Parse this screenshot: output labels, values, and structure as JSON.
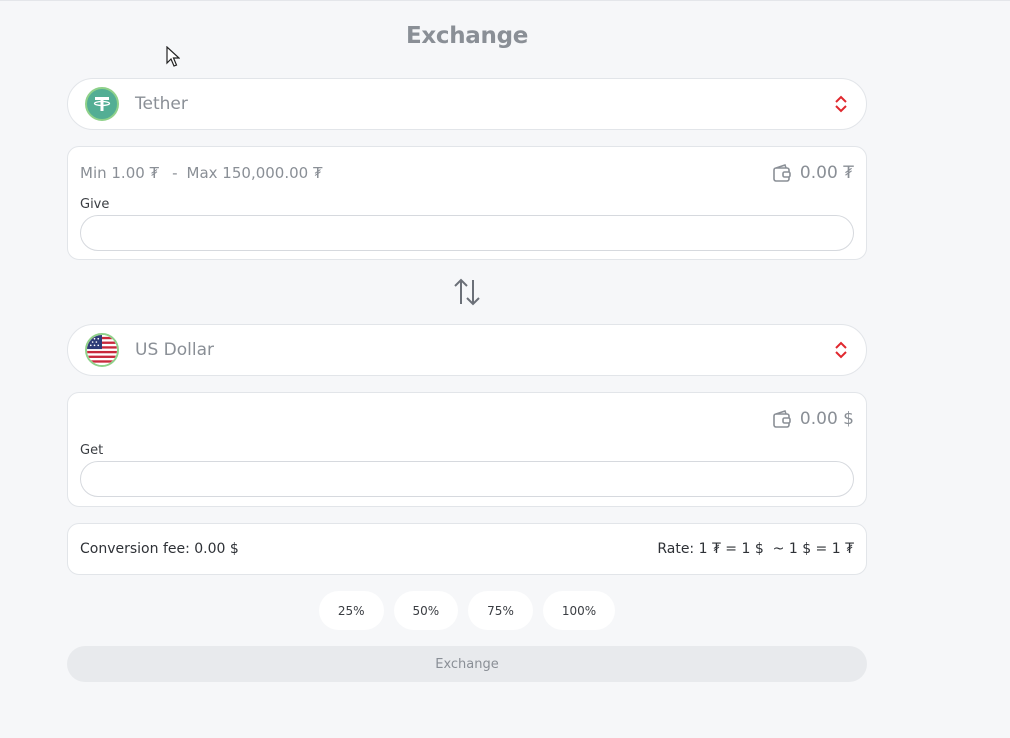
{
  "page": {
    "title": "Exchange"
  },
  "give": {
    "currency": "Tether",
    "min_label": "Min 1.00 ₮",
    "separator": "-",
    "max_label": "Max 150,000.00 ₮",
    "balance": "0.00 ₮",
    "field_label": "Give",
    "value": "",
    "placeholder": ""
  },
  "get": {
    "currency": "US Dollar",
    "balance": "0.00 $",
    "field_label": "Get",
    "value": "",
    "placeholder": ""
  },
  "info": {
    "fee": "Conversion fee: 0.00 $",
    "rate": "Rate: 1 ₮ = 1 $  ~ 1 $ = 1 ₮"
  },
  "percent_buttons": [
    "25%",
    "50%",
    "75%",
    "100%"
  ],
  "submit_label": "Exchange",
  "colors": {
    "background": "#f6f7f9",
    "tether": "#53ae94",
    "chevron": "#e0282e",
    "button_disabled": "#e8eaed"
  },
  "icons": {
    "tether": "tether-coin-icon",
    "usd": "us-flag-icon",
    "chevron": "chevron-up-down-icon",
    "wallet": "wallet-icon",
    "swap": "swap-arrows-icon"
  }
}
